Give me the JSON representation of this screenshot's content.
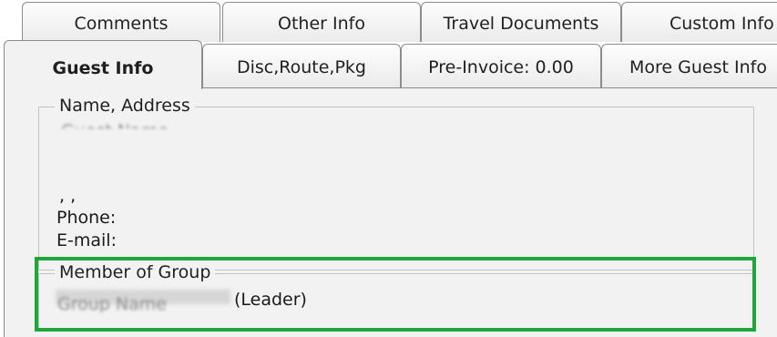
{
  "tabs": {
    "row1": [
      "Comments",
      "Other Info",
      "Travel Documents",
      "Custom Info"
    ],
    "row2": [
      "Guest Info",
      "Disc,Route,Pkg",
      "Pre-Invoice: 0.00",
      "More Guest Info"
    ],
    "active": "Guest Info"
  },
  "name_address": {
    "legend": "Name, Address",
    "address_line": ", ,",
    "phone_label": "Phone:",
    "email_label": "E-mail:"
  },
  "member_of_group": {
    "legend": "Member of Group",
    "role_suffix": "(Leader)"
  },
  "colors": {
    "highlight": "#1fa53c",
    "panel_bg": "#f2f2f2"
  }
}
